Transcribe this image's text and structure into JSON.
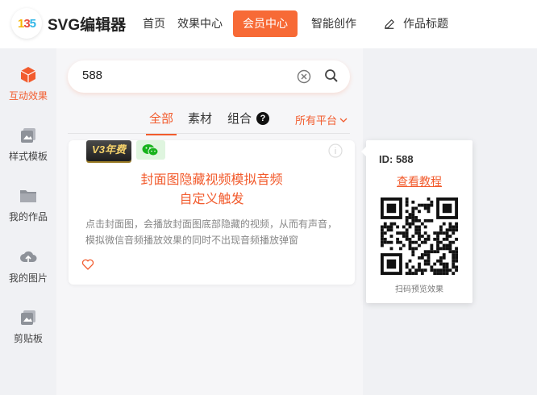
{
  "header": {
    "app_name": "SVG编辑器",
    "logo_text": [
      "1",
      "3",
      "5"
    ],
    "nav": {
      "home": "首页",
      "effects": "效果中心",
      "member": "会员中心",
      "smart": "智能创作",
      "work_title": "作品标题"
    }
  },
  "sidebar": {
    "items": [
      {
        "label": "互动效果",
        "icon": "cube-icon",
        "active": true
      },
      {
        "label": "样式模板",
        "icon": "template-icon",
        "active": false
      },
      {
        "label": "我的作品",
        "icon": "folder-icon",
        "active": false
      },
      {
        "label": "我的图片",
        "icon": "cloud-upload-icon",
        "active": false
      },
      {
        "label": "剪贴板",
        "icon": "clipboard-icon",
        "active": false
      }
    ]
  },
  "search": {
    "value": "588"
  },
  "tabs": {
    "all": "全部",
    "material": "素材",
    "combo": "组合",
    "help": "?",
    "platform": "所有平台"
  },
  "card": {
    "badge": "V3年费",
    "title_line1": "封面图隐藏视频模拟音频",
    "title_line2": "自定义触发",
    "description": "点击封面图，会播放封面图底部隐藏的视频，从而有声音，模拟微信音频播放效果的同时不出现音频播放弹窗"
  },
  "popup": {
    "id_text": "ID: 588",
    "link": "查看教程",
    "caption": "扫码预览效果"
  },
  "colors": {
    "accent": "#f25b2d",
    "member_button": "#f76a36"
  }
}
